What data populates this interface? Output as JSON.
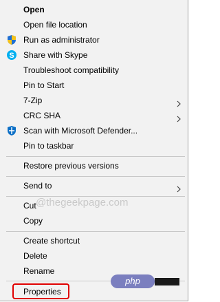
{
  "menu": {
    "items": [
      {
        "label": "Open",
        "bold": true,
        "icon": ""
      },
      {
        "label": "Open file location",
        "icon": ""
      },
      {
        "label": "Run as administrator",
        "icon": "uac-shield-icon"
      },
      {
        "label": "Share with Skype",
        "icon": "skype-icon"
      },
      {
        "label": "Troubleshoot compatibility",
        "icon": ""
      },
      {
        "label": "Pin to Start",
        "icon": ""
      },
      {
        "label": "7-Zip",
        "icon": "",
        "submenu": true
      },
      {
        "label": "CRC SHA",
        "icon": "",
        "submenu": true
      },
      {
        "label": "Scan with Microsoft Defender...",
        "icon": "defender-shield-icon"
      },
      {
        "label": "Pin to taskbar",
        "icon": ""
      },
      {
        "label": "Restore previous versions",
        "icon": ""
      },
      {
        "label": "Send to",
        "icon": "",
        "submenu": true
      },
      {
        "label": "Cut",
        "icon": ""
      },
      {
        "label": "Copy",
        "icon": ""
      },
      {
        "label": "Create shortcut",
        "icon": ""
      },
      {
        "label": "Delete",
        "icon": ""
      },
      {
        "label": "Rename",
        "icon": ""
      },
      {
        "label": "Properties",
        "icon": "",
        "highlighted": true
      }
    ]
  },
  "watermark": "@thegeekpage.com",
  "badge": "php",
  "colors": {
    "menu_background": "#f2f2f2",
    "highlight_border": "#e00000",
    "uac_blue": "#1f6fd1",
    "uac_yellow": "#f4c21b",
    "skype_blue": "#00aff0",
    "defender_blue": "#0b6fc6",
    "php_badge": "#7b7fbf"
  }
}
